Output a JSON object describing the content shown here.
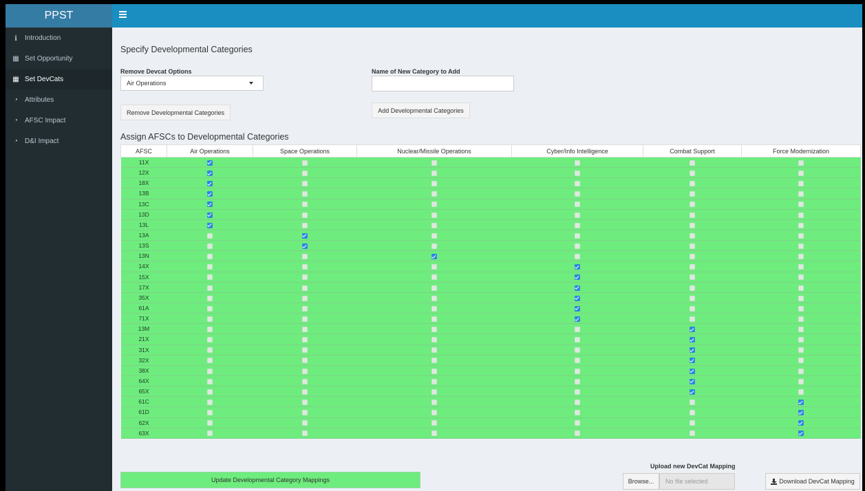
{
  "app": {
    "title": "PPST"
  },
  "sidebar": {
    "items": [
      {
        "label": "Introduction",
        "icon": "info-icon",
        "glyph": "i",
        "active": false
      },
      {
        "label": "Set Opportunity",
        "icon": "table-icon",
        "glyph": "▦",
        "active": false
      },
      {
        "label": "Set DevCats",
        "icon": "table-icon",
        "glyph": "▦",
        "active": true
      },
      {
        "label": "Attributes",
        "icon": "dashboard-icon",
        "glyph": "◔",
        "active": false
      },
      {
        "label": "AFSC Impact",
        "icon": "dashboard-icon",
        "glyph": "◔",
        "active": false
      },
      {
        "label": "D&I Impact",
        "icon": "dashboard-icon",
        "glyph": "◔",
        "active": false
      }
    ]
  },
  "main": {
    "section_title": "Specify Developmental Categories",
    "remove_label": "Remove Devcat Options",
    "remove_selected": "Air Operations",
    "add_label": "Name of New Category to Add",
    "add_value": "",
    "remove_button": "Remove Developmental Categories",
    "add_button": "Add Developmental Categories",
    "assign_title": "Assign AFSCs to Developmental Categories"
  },
  "table": {
    "columns": [
      "AFSC",
      "Air Operations",
      "Space Operations",
      "Nuclear/Missile Operations",
      "Cyber/Info Intelligence",
      "Combat Support",
      "Force Modernization"
    ],
    "rows": [
      {
        "afsc": "11X",
        "checked": [
          1,
          0,
          0,
          0,
          0,
          0
        ]
      },
      {
        "afsc": "12X",
        "checked": [
          1,
          0,
          0,
          0,
          0,
          0
        ]
      },
      {
        "afsc": "18X",
        "checked": [
          1,
          0,
          0,
          0,
          0,
          0
        ]
      },
      {
        "afsc": "13B",
        "checked": [
          1,
          0,
          0,
          0,
          0,
          0
        ]
      },
      {
        "afsc": "13C",
        "checked": [
          1,
          0,
          0,
          0,
          0,
          0
        ]
      },
      {
        "afsc": "13D",
        "checked": [
          1,
          0,
          0,
          0,
          0,
          0
        ]
      },
      {
        "afsc": "13L",
        "checked": [
          1,
          0,
          0,
          0,
          0,
          0
        ]
      },
      {
        "afsc": "13A",
        "checked": [
          0,
          1,
          0,
          0,
          0,
          0
        ]
      },
      {
        "afsc": "13S",
        "checked": [
          0,
          1,
          0,
          0,
          0,
          0
        ]
      },
      {
        "afsc": "13N",
        "checked": [
          0,
          0,
          1,
          0,
          0,
          0
        ]
      },
      {
        "afsc": "14X",
        "checked": [
          0,
          0,
          0,
          1,
          0,
          0
        ]
      },
      {
        "afsc": "15X",
        "checked": [
          0,
          0,
          0,
          1,
          0,
          0
        ]
      },
      {
        "afsc": "17X",
        "checked": [
          0,
          0,
          0,
          1,
          0,
          0
        ]
      },
      {
        "afsc": "35X",
        "checked": [
          0,
          0,
          0,
          1,
          0,
          0
        ]
      },
      {
        "afsc": "61A",
        "checked": [
          0,
          0,
          0,
          1,
          0,
          0
        ]
      },
      {
        "afsc": "71X",
        "checked": [
          0,
          0,
          0,
          1,
          0,
          0
        ]
      },
      {
        "afsc": "13M",
        "checked": [
          0,
          0,
          0,
          0,
          1,
          0
        ]
      },
      {
        "afsc": "21X",
        "checked": [
          0,
          0,
          0,
          0,
          1,
          0
        ]
      },
      {
        "afsc": "31X",
        "checked": [
          0,
          0,
          0,
          0,
          1,
          0
        ]
      },
      {
        "afsc": "32X",
        "checked": [
          0,
          0,
          0,
          0,
          1,
          0
        ]
      },
      {
        "afsc": "38X",
        "checked": [
          0,
          0,
          0,
          0,
          1,
          0
        ]
      },
      {
        "afsc": "64X",
        "checked": [
          0,
          0,
          0,
          0,
          1,
          0
        ]
      },
      {
        "afsc": "65X",
        "checked": [
          0,
          0,
          0,
          0,
          1,
          0
        ]
      },
      {
        "afsc": "61C",
        "checked": [
          0,
          0,
          0,
          0,
          0,
          1
        ]
      },
      {
        "afsc": "61D",
        "checked": [
          0,
          0,
          0,
          0,
          0,
          1
        ]
      },
      {
        "afsc": "62X",
        "checked": [
          0,
          0,
          0,
          0,
          0,
          1
        ]
      },
      {
        "afsc": "63X",
        "checked": [
          0,
          0,
          0,
          0,
          0,
          1
        ]
      }
    ]
  },
  "footer": {
    "update_button": "Update Developmental Category Mappings",
    "upload_label": "Upload new DevCat Mapping",
    "browse_button": "Browse...",
    "file_placeholder": "No file selected",
    "download_button": "Download DevCat Mapping"
  },
  "colors": {
    "header": "#1a8ec0",
    "logo": "#357ca5",
    "sidebar": "#222d32",
    "row_green": "#6eec7d",
    "checkbox_blue": "#2d86e2"
  }
}
